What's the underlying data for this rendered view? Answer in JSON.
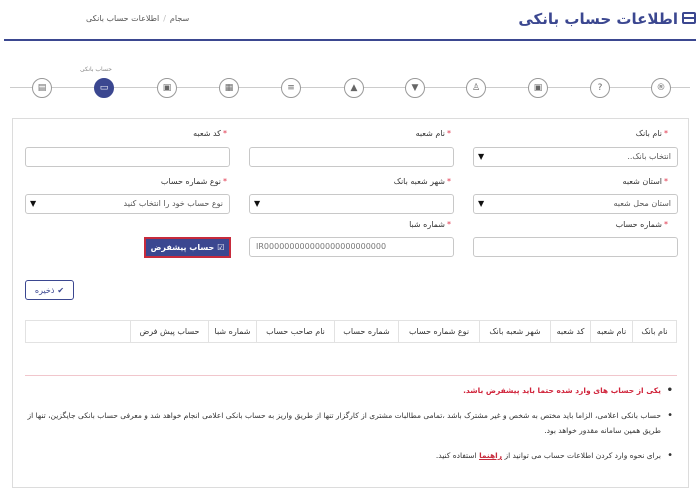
{
  "header": {
    "title": "اطلاعات حساب بانکی",
    "breadcrumb_home": "سجام",
    "breadcrumb_current": "اطلاعات حساب بانکی"
  },
  "stepper": {
    "active_label": "حساب بانکی"
  },
  "form": {
    "bank_name_label": "نام بانک",
    "bank_name_value": "انتخاب بانک..",
    "branch_name_label": "نام شعبه",
    "branch_name_value": "",
    "branch_code_label": "کد شعبه",
    "branch_code_value": "",
    "branch_province_label": "استان شعبه",
    "branch_province_value": "استان محل شعبه",
    "branch_city_label": "شهر شعبه بانک",
    "branch_city_value": "",
    "account_type_label": "نوع شماره حساب",
    "account_type_value": "نوع حساب خود را انتخاب کنید",
    "account_number_label": "شماره حساب",
    "account_number_value": "",
    "sheba_label": "شماره شبا",
    "sheba_value": "IR000000000000000000000000",
    "default_button": "حساب پیشفرض",
    "save_button": "ذخیره"
  },
  "table": {
    "headers": [
      "نام بانک",
      "نام شعبه",
      "کد شعبه",
      "شهر شعبه بانک",
      "نوع شماره حساب",
      "شماره حساب",
      "نام صاحب حساب",
      "شماره شبا",
      "حساب پیش فرض"
    ]
  },
  "notes": {
    "n1": "یکی از حساب های وارد شده حتما باید پیشفرض باشد.",
    "n2": "حساب بانکی اعلامی، الزاما باید مختص به شخص و غیر مشترک باشد ،تمامی مطالبات مشتری از کارگزار تنها از طریق واریز به حساب بانکی اعلامی انجام خواهد شد و معرفی حساب بانکی جایگزین، تنها از طریق همین سامانه مقدور خواهد بود.",
    "n3_pre": "برای نحوه وارد کردن اطلاعات حساب می توانید از",
    "n3_link": "راهنما",
    "n3_post": "استفاده کنید."
  },
  "colors": {
    "primary": "#3b4790",
    "danger": "#c72b3c"
  }
}
